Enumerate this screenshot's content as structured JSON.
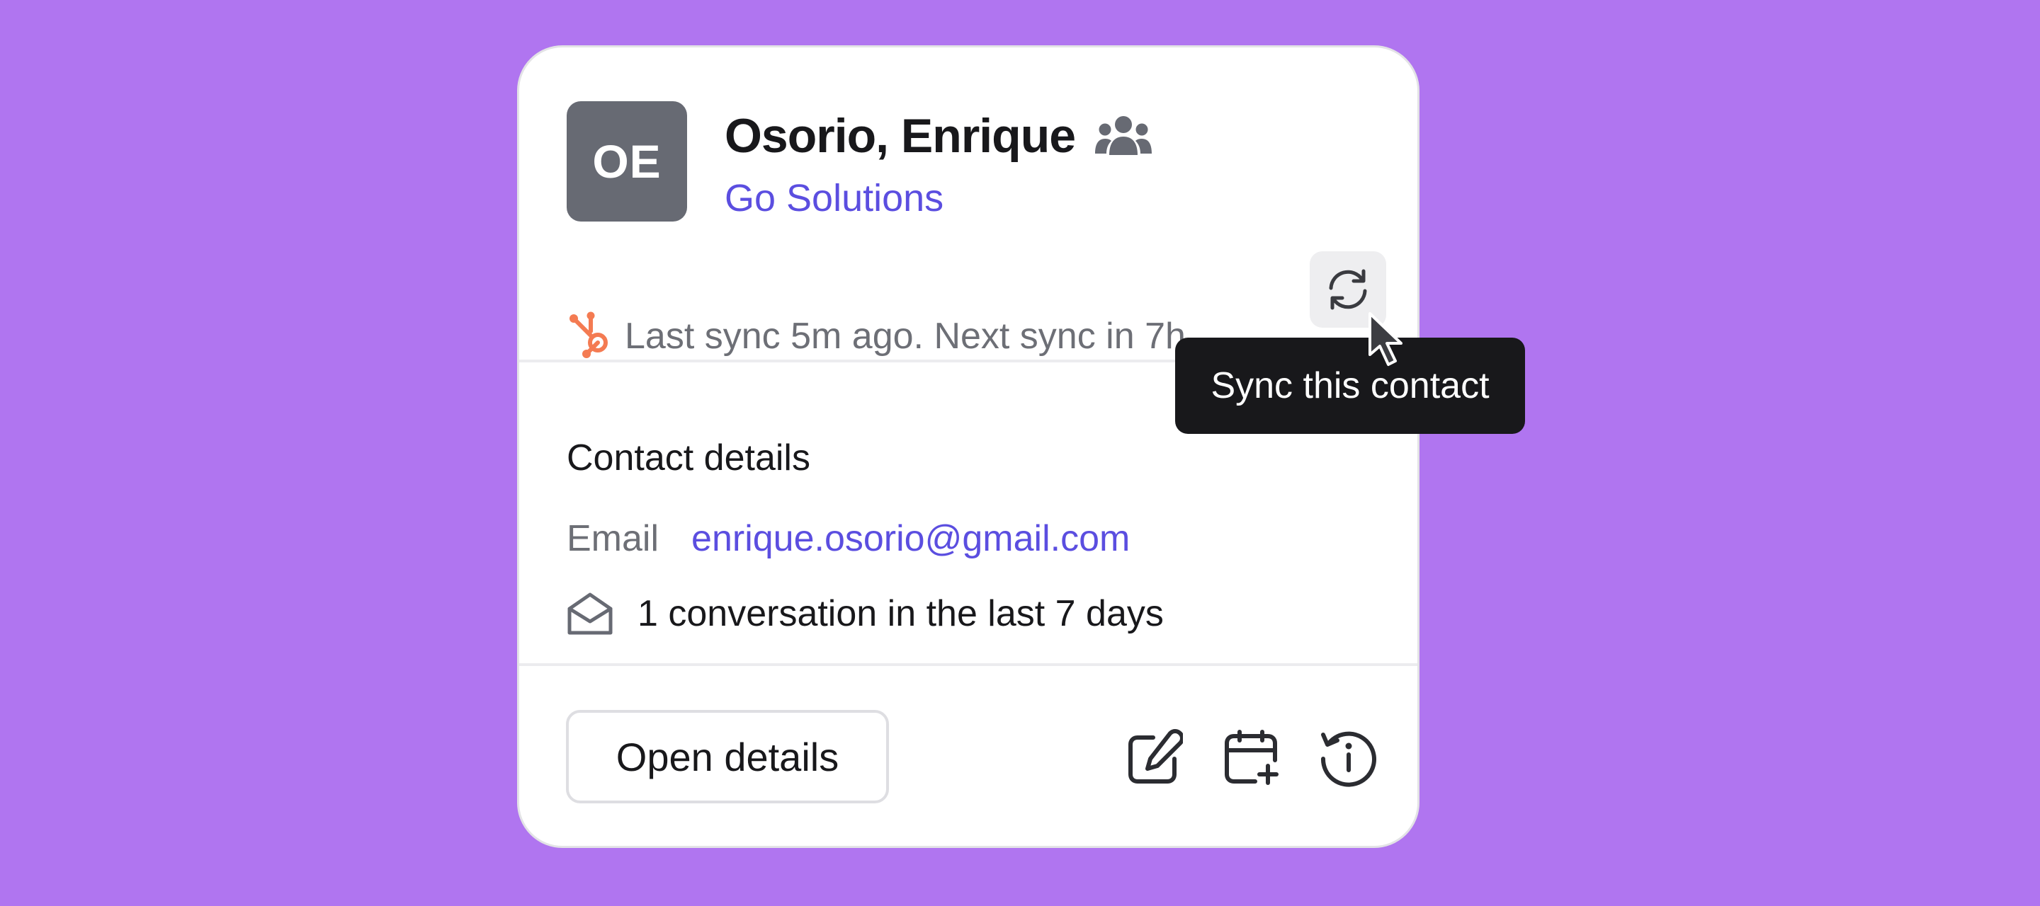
{
  "contact": {
    "initials": "OE",
    "name": "Osorio, Enrique",
    "company": "Go Solutions"
  },
  "sync": {
    "status_text": "Last sync 5m ago. Next sync in 7h.",
    "tooltip": "Sync this contact",
    "source_icon": "hubspot-icon",
    "button_icon": "refresh-icon"
  },
  "details": {
    "section_title": "Contact details",
    "email_label": "Email",
    "email_value": "enrique.osorio@gmail.com",
    "conversations_text": "1 conversation in the last 7 days"
  },
  "footer": {
    "open_details_label": "Open details",
    "actions": [
      "edit-icon",
      "calendar-add-icon",
      "history-info-icon"
    ]
  },
  "colors": {
    "background": "#b075f0",
    "accent": "#5b4ee0",
    "avatar": "#676a73",
    "hubspot": "#f47b52",
    "tooltip": "#18181b"
  }
}
